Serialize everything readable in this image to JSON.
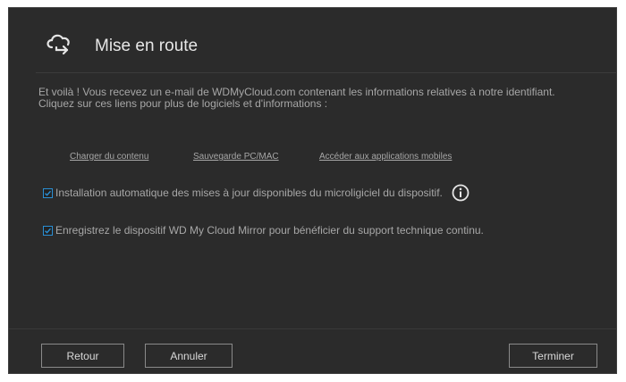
{
  "dialog": {
    "title": "Mise en route",
    "header_icon": "cloud-arrow-icon",
    "intro_line1": "Et voilà ! Vous recevez un e-mail de WDMyCloud.com contenant les informations relatives à notre identifiant.",
    "intro_line2": "Cliquez sur ces liens pour plus de logiciels et d'informations :",
    "links": [
      "Charger du contenu",
      "Sauvegarde PC/MAC",
      "Accéder aux applications mobiles"
    ],
    "options": [
      {
        "label": "Installation automatique des mises à jour disponibles du microligiciel du dispositif.",
        "checked": true
      },
      {
        "label": "Enregistrez le dispositif WD My Cloud Mirror pour bénéficier du support technique continu.",
        "checked": true
      }
    ],
    "info_icon": "info-icon",
    "buttons": {
      "back": "Retour",
      "cancel": "Annuler",
      "finish": "Terminer"
    },
    "colors": {
      "background": "#2b2b2b",
      "text": "#a7a7a7",
      "checkbox_accent": "#2a8fd4"
    }
  }
}
